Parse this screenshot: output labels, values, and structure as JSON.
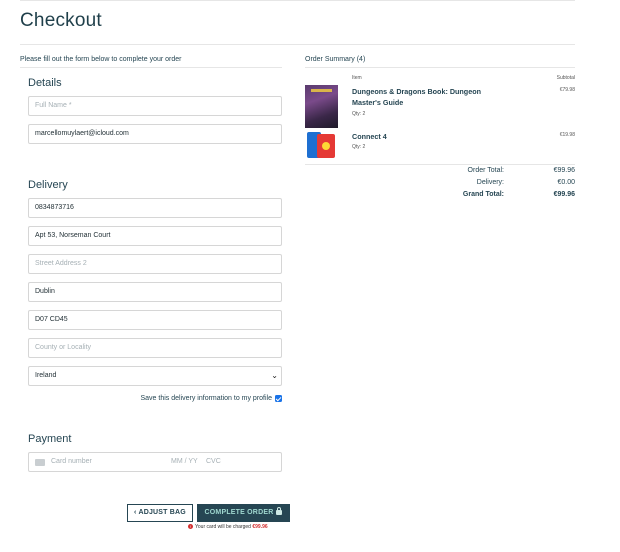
{
  "page": {
    "title": "Checkout"
  },
  "form": {
    "instruction": "Please fill out the form below to complete your order",
    "details": {
      "heading": "Details",
      "full_name_placeholder": "Full Name *",
      "email_value": "marcellomuylaert@icloud.com"
    },
    "delivery": {
      "heading": "Delivery",
      "phone_value": "0834873716",
      "street1_value": "Apt 53, Norseman Court",
      "street2_placeholder": "Street Address 2",
      "town_value": "Dublin",
      "postcode_value": "D07 CD45",
      "county_placeholder": "County or Locality",
      "country_selected": "Ireland",
      "save_label": "Save this delivery information to my profile",
      "save_checked": true
    },
    "payment": {
      "heading": "Payment",
      "card_number_placeholder": "Card number",
      "expiry_placeholder": "MM / YY",
      "cvc_placeholder": "CVC"
    },
    "actions": {
      "adjust_label": "ADJUST BAG",
      "complete_label": "COMPLETE ORDER",
      "charge_note": "Your card will be charged",
      "charge_amount": "€99.96"
    }
  },
  "summary": {
    "title": "Order Summary (4)",
    "col_item": "Item",
    "col_subtotal": "Subtotal",
    "items": [
      {
        "name": "Dungeons & Dragons Book: Dungeon Master's Guide",
        "qty": "Qty: 2",
        "subtotal": "€79.98"
      },
      {
        "name": "Connect 4",
        "qty": "Qty: 2",
        "subtotal": "€19.98"
      }
    ],
    "totals": {
      "order_total_label": "Order Total:",
      "order_total": "€99.96",
      "delivery_label": "Delivery:",
      "delivery": "€0.00",
      "grand_total_label": "Grand Total:",
      "grand_total": "€99.96"
    }
  },
  "colors": {
    "primary": "#264653",
    "accent_text": "#9fd7cf",
    "error": "#d32f2f",
    "checkbox": "#1a73e8"
  },
  "icons": [
    "chevron-left-icon",
    "lock-icon",
    "card-icon",
    "alert-icon",
    "chevron-down-icon",
    "checkbox-checked-icon"
  ]
}
